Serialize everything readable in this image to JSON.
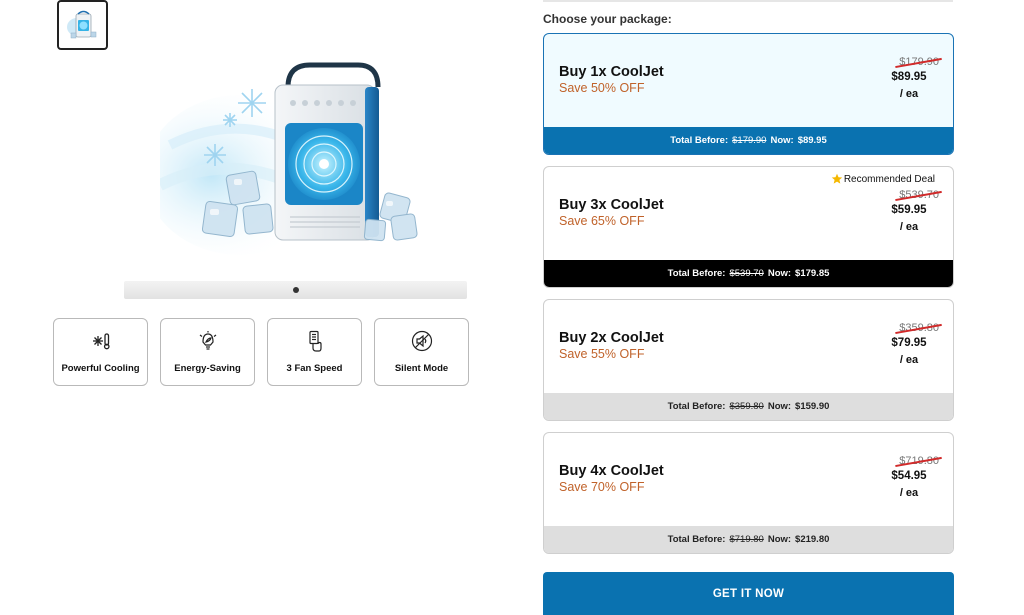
{
  "gallery": {
    "thumbnail_icon": "cooler-thumbnail-image",
    "main_image_icon": "cooljet-air-cooler-with-ice-image",
    "page_indicator": {
      "current": 1,
      "total": 1
    }
  },
  "features": [
    {
      "icon": "snowflake-thermometer-icon",
      "label": "Powerful Cooling"
    },
    {
      "icon": "leaf-bulb-icon",
      "label": "Energy-Saving"
    },
    {
      "icon": "hand-remote-icon",
      "label": "3 Fan Speed"
    },
    {
      "icon": "mute-speaker-icon",
      "label": "Silent Mode"
    }
  ],
  "packages_heading": "Choose your package:",
  "packages": [
    {
      "name": "Buy 1x CoolJet",
      "save": "Save 50% OFF",
      "old_price": "$179.90",
      "price": "$89.95",
      "unit": "/ ea",
      "badge": "",
      "total_before_label": "Total Before:",
      "total_before": "$179.90",
      "now_label": "Now:",
      "now": "$89.95",
      "selected": true,
      "bar_color": "#0a72b0"
    },
    {
      "name": "Buy 3x CoolJet",
      "save": "Save 65% OFF",
      "old_price": "$539.70",
      "price": "$59.95",
      "unit": "/ ea",
      "badge": "Recommended Deal",
      "total_before_label": "Total Before:",
      "total_before": "$539.70",
      "now_label": "Now:",
      "now": "$179.85",
      "selected": false,
      "bar_color": "#000000"
    },
    {
      "name": "Buy 2x CoolJet",
      "save": "Save 55% OFF",
      "old_price": "$359.80",
      "price": "$79.95",
      "unit": "/ ea",
      "badge": "",
      "total_before_label": "Total Before:",
      "total_before": "$359.80",
      "now_label": "Now:",
      "now": "$159.90",
      "selected": false,
      "bar_color": "#dedede"
    },
    {
      "name": "Buy 4x CoolJet",
      "save": "Save 70% OFF",
      "old_price": "$719.80",
      "price": "$54.95",
      "unit": "/ ea",
      "badge": "",
      "total_before_label": "Total Before:",
      "total_before": "$719.80",
      "now_label": "Now:",
      "now": "$219.80",
      "selected": false,
      "bar_color": "#dedede"
    }
  ],
  "cta_label": "GET IT NOW",
  "colors": {
    "accent": "#0a72b0",
    "save_text": "#c0622a",
    "strike": "#d12a2a",
    "star": "#f5b800"
  }
}
